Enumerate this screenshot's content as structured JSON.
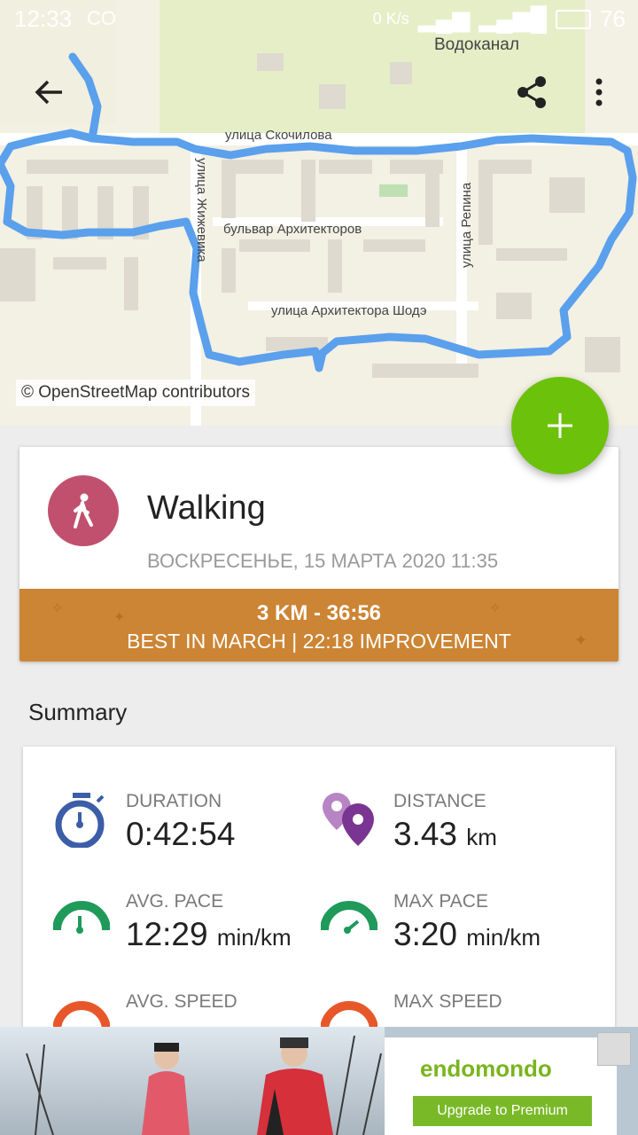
{
  "status_bar": {
    "time": "12:33",
    "carrier_icon": "co-icon",
    "speed": "0 K/s",
    "battery": "76"
  },
  "map": {
    "labels": {
      "vodokanal": "Водоканал",
      "skochilova": "улица Скочилова",
      "zhizhevika": "улица Жижевика",
      "bulvar": "бульвар Архитекторов",
      "repina": "улица Репина",
      "shoda": "улица Архитектора Шодэ"
    },
    "attribution": "© OpenStreetMap contributors",
    "route_color": "#5aa0ec"
  },
  "toolbar": {
    "back_icon": "arrow-left-icon",
    "share_icon": "share-icon",
    "more_icon": "more-vert-icon"
  },
  "fab": {
    "icon": "plus-icon",
    "color": "#6cc20b"
  },
  "workout": {
    "sport": "Walking",
    "date": "ВОСКРЕСЕНЬЕ, 15 МАРТА 2020 11:35",
    "best_line1": "3 KM  -  36:56",
    "best_line2": "BEST IN MARCH  |  22:18 IMPROVEMENT",
    "sport_color": "#c0506e",
    "banner_color": "#cc8534"
  },
  "summary": {
    "title": "Summary",
    "stats": [
      {
        "label": "DURATION",
        "value": "0:42:54",
        "unit": "",
        "icon": "stopwatch-icon"
      },
      {
        "label": "DISTANCE",
        "value": "3.43",
        "unit": "km",
        "icon": "map-pins-icon"
      },
      {
        "label": "AVG. PACE",
        "value": "12:29",
        "unit": "min/km",
        "icon": "speedometer-icon"
      },
      {
        "label": "MAX PACE",
        "value": "3:20",
        "unit": "min/km",
        "icon": "speedometer-icon"
      },
      {
        "label": "AVG. SPEED",
        "value": "",
        "unit": "",
        "icon": "speedometer-icon"
      },
      {
        "label": "MAX SPEED",
        "value": "",
        "unit": "",
        "icon": "speedometer-icon"
      }
    ]
  },
  "ad": {
    "brand": "endomondo",
    "cta": "Upgrade to Premium"
  }
}
